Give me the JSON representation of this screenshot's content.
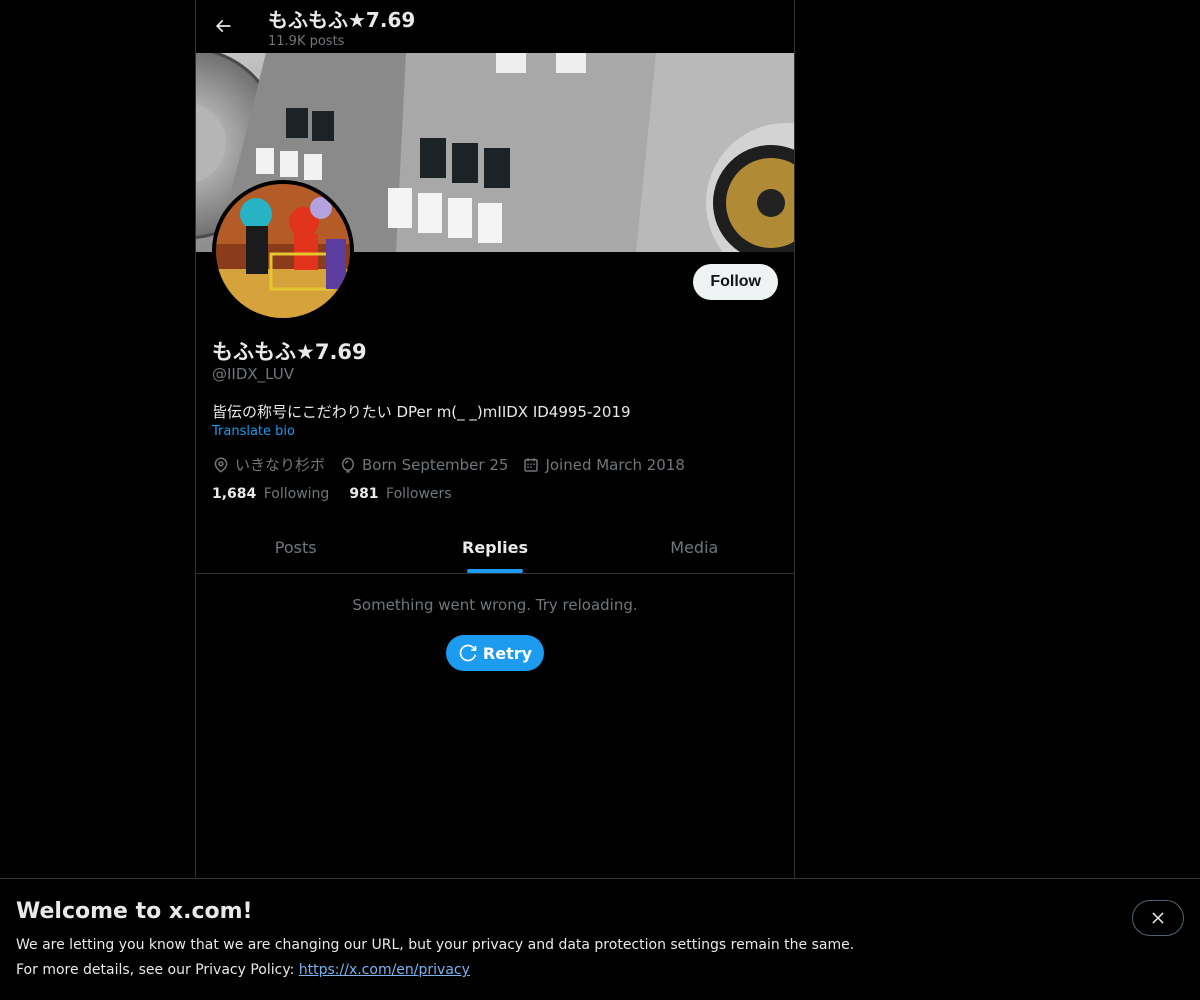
{
  "header": {
    "title": "もふもふ★7.69",
    "subtitle": "11.9K posts",
    "back_icon": "arrow-left-icon"
  },
  "profile": {
    "name": "もふもふ★7.69",
    "handle": "@IIDX_LUV",
    "bio": "皆伝の称号にこだわりたい DPer m(_ _)mIIDX ID4995-2019",
    "translate_label": "Translate bio",
    "follow_label": "Follow",
    "location": "いきなり杉ボ",
    "birthday": "Born September 25",
    "joined": "Joined March 2018",
    "following_count": "1,684",
    "following_label": "Following",
    "followers_count": "981",
    "followers_label": "Followers"
  },
  "tabs": [
    {
      "label": "Posts",
      "active": false
    },
    {
      "label": "Replies",
      "active": true
    },
    {
      "label": "Media",
      "active": false
    }
  ],
  "feed": {
    "error_text": "Something went wrong. Try reloading.",
    "retry_label": "Retry"
  },
  "notice": {
    "title": "Welcome to x.com!",
    "line1": "We are letting you know that we are changing our URL, but your privacy and data protection settings remain the same.",
    "line2_prefix": "For more details, see our Privacy Policy: ",
    "link_text": "https://x.com/en/privacy"
  },
  "colors": {
    "background": "#000000",
    "accent": "#1d9bf0",
    "text_primary": "#e7e9ea",
    "text_secondary": "#71767b",
    "border": "#2f3336",
    "follow_button_bg": "#eff3f4"
  }
}
